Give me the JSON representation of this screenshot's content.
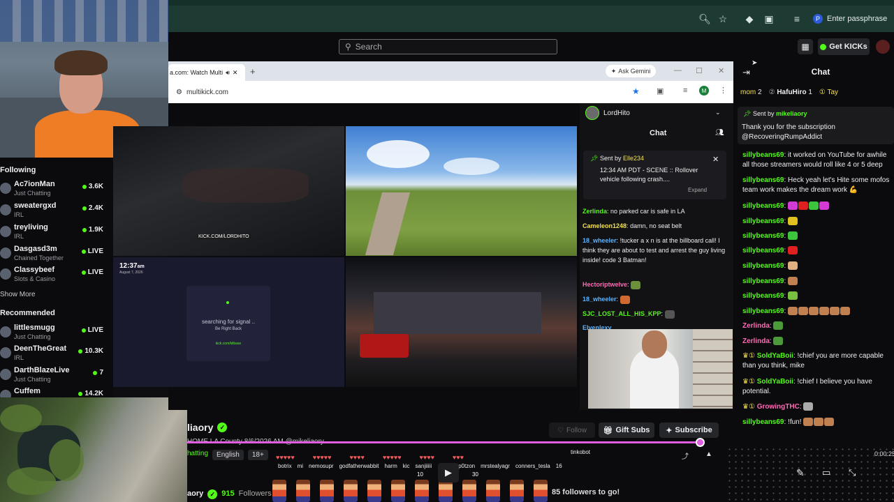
{
  "browser": {
    "passphrase_label": "Enter passphrase",
    "passphrase_badge": "P"
  },
  "kick": {
    "search_placeholder": "Search",
    "get_kicks_label": "Get KICKs"
  },
  "sidebar": {
    "following_header": "Following",
    "following": [
      {
        "name": "Ac7ionMan",
        "category": "Just Chatting",
        "count": "3.6K"
      },
      {
        "name": "sweatergxd",
        "category": "IRL",
        "count": "2.4K"
      },
      {
        "name": "treyliving",
        "category": "IRL",
        "count": "1.9K"
      },
      {
        "name": "Dasgasd3m",
        "category": "Chained Together",
        "count": "LIVE"
      },
      {
        "name": "Classybeef",
        "category": "Slots & Casino",
        "count": "LIVE"
      }
    ],
    "show_more": "Show More",
    "recommended_header": "Recommended",
    "recommended": [
      {
        "name": "littlesmugg",
        "category": "Just Chatting",
        "count": "LIVE"
      },
      {
        "name": "DeenTheGreat",
        "category": "IRL",
        "count": "10.3K"
      },
      {
        "name": "DarthBlazeLive",
        "category": "Just Chatting",
        "count": "7"
      },
      {
        "name": "Cuffem",
        "category": "",
        "count": "14.2K"
      }
    ]
  },
  "inner_browser": {
    "tab_title": "a.com: Watch Multi",
    "ask_gemini": "Ask Gemini",
    "url": "multikick.com",
    "profile_initial": "M"
  },
  "tiles": {
    "tile1_url": "KICK.COM/LORDHITO",
    "tile3_time": "12:37",
    "tile3_time_suffix": "am",
    "tile3_date": "August 7, 2026",
    "tile3_status": "searching for signal ..",
    "tile3_back": "Be Right Back",
    "tile3_url": "kick.com/kilbase"
  },
  "inner_chat": {
    "streamer": "LordHito",
    "title": "Chat",
    "pinned_sent_by": "Sent by",
    "pinned_user": "Elle234",
    "pinned_text": "12:34 AM PDT - SCENE :: Rollover vehicle following crash....",
    "pinned_expand": "Expand",
    "messages": [
      {
        "user": "Zerlinda",
        "text": "no parked car is safe in LA"
      },
      {
        "user": "Cameleon1248",
        "text": "damn, no seat belt"
      },
      {
        "user": "18_wheeler",
        "text": "!tucker a x n is at the billboard call! I think they are about to test and arrest the guy living inside! code 3 Batman!"
      },
      {
        "user": "Hectoriptwelve",
        "text": ""
      },
      {
        "user": "18_wheeler",
        "text": ""
      },
      {
        "user": "SJC_LOST_ALL_HIS_KPP",
        "text": ""
      },
      {
        "user": "Elvenlexy",
        "text": ""
      }
    ]
  },
  "chat": {
    "title": "Chat",
    "top_gifters": [
      {
        "name": "mom",
        "count": "2"
      },
      {
        "name": "HafuHiro",
        "count": "1"
      },
      {
        "name": "Tay",
        "count": ""
      }
    ],
    "pinned_sent_by": "Sent by",
    "pinned_user": "mikeliaory",
    "pinned_text": "Thank you for the subscription @RecoveringRumpAddict",
    "messages": [
      {
        "user": "sillybeans69",
        "text": "it worked on YouTube for awhile all those streamers would roll like 4 or 5 deep"
      },
      {
        "user": "sillybeans69",
        "text": "Heck yeah let's Hite some mofos team work makes the dream work 💪"
      },
      {
        "user": "sillybeans69",
        "text": ""
      },
      {
        "user": "sillybeans69",
        "text": ""
      },
      {
        "user": "sillybeans69",
        "text": ""
      },
      {
        "user": "sillybeans69",
        "text": ""
      },
      {
        "user": "sillybeans69",
        "text": ""
      },
      {
        "user": "sillybeans69",
        "text": ""
      },
      {
        "user": "sillybeans69",
        "text": ""
      },
      {
        "user": "sillybeans69",
        "text": ""
      },
      {
        "user": "Zerlinda",
        "text": ""
      },
      {
        "user": "Zerlinda",
        "text": ""
      },
      {
        "user": "SoldYaBoii",
        "text": "!chief you are more capable than you think, mike"
      },
      {
        "user": "SoldYaBoii",
        "text": "!chief I believe you have potential."
      },
      {
        "user": "GrowingTHC",
        "text": ""
      },
      {
        "user": "sillybeans69",
        "text": "!fun!"
      }
    ]
  },
  "stream": {
    "channel": "mikeliaory",
    "channel_visible": "liaory",
    "title": "HOME LA County 8/6/2026 AM @mikeliaory",
    "category": "Just Chatting",
    "category_visible": "hatting",
    "language": "English",
    "age": "18+",
    "follow_label": "Follow",
    "gift_label": "Gift Subs",
    "subscribe_label": "Subscribe",
    "followers_count": "915",
    "followers_label": "Followers",
    "channel_bottom": "aory",
    "goal_text": "85 followers to go!",
    "time": "0:00:25",
    "progress": 0.99,
    "bar_names": [
      "botrix",
      "mi",
      "nemosupr",
      "godfatherwabbit",
      "harm",
      "kic",
      "sanjiiiii",
      "p0tzon",
      "mrstealyagr",
      "conners_tesla",
      "tinkobot"
    ],
    "bar_numbers": [
      "10",
      "30",
      "16"
    ]
  }
}
